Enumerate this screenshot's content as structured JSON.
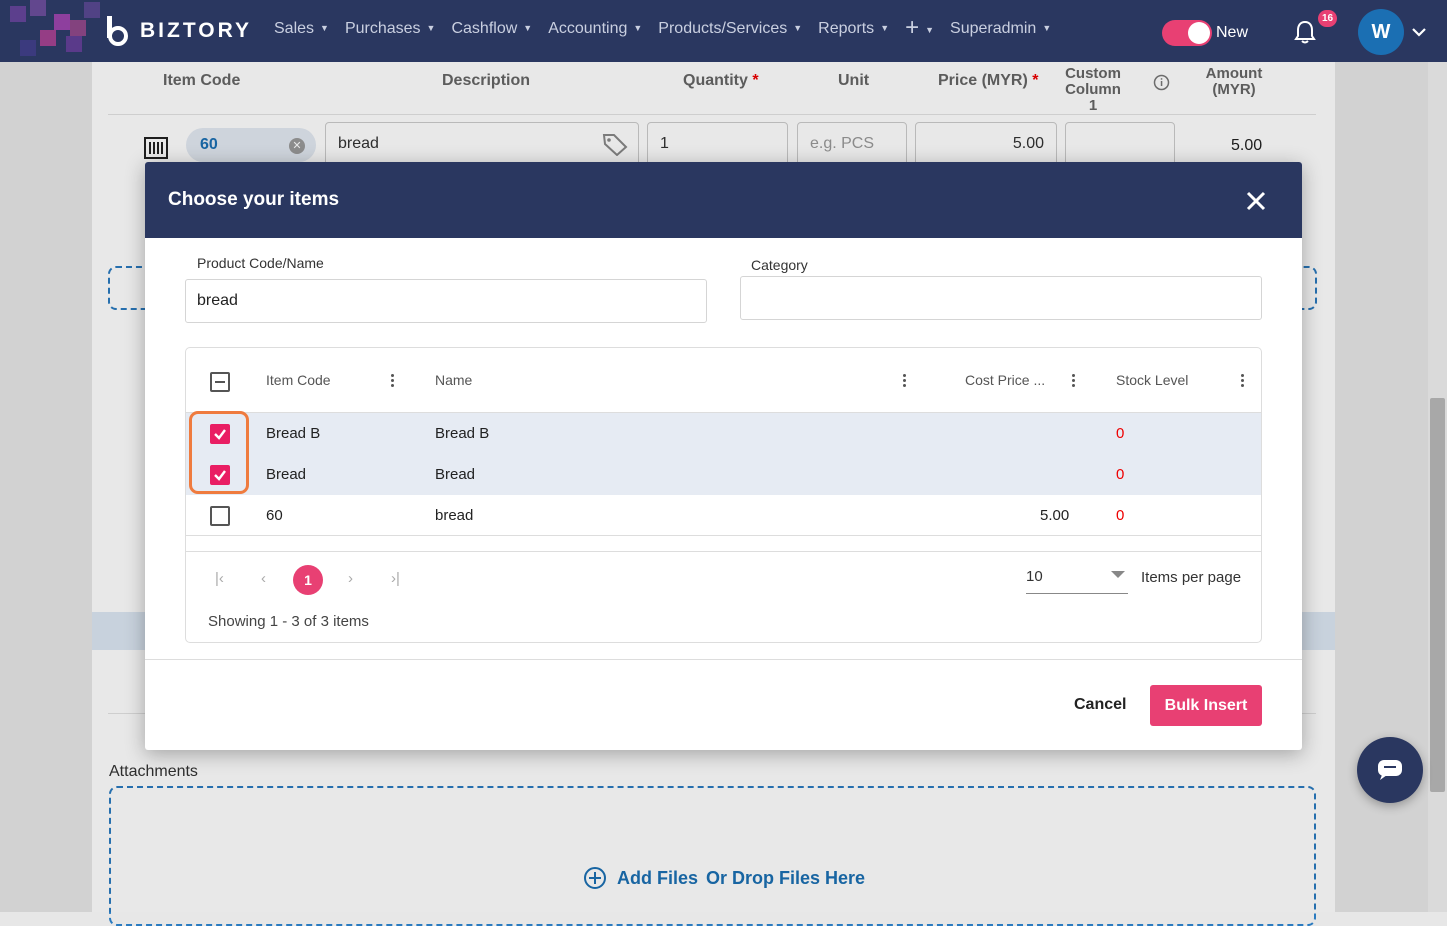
{
  "topnav": {
    "brand": "BIZTORY",
    "menu": [
      {
        "label": "Sales"
      },
      {
        "label": "Purchases"
      },
      {
        "label": "Cashflow"
      },
      {
        "label": "Accounting"
      },
      {
        "label": "Products/Services"
      },
      {
        "label": "Reports"
      },
      {
        "label": "+"
      },
      {
        "label": "Superadmin"
      }
    ],
    "toggle_label": "New",
    "notification_count": "16",
    "avatar_initial": "W",
    "brand_color": "#2a3760",
    "accent_color": "#e84073"
  },
  "background": {
    "columns": {
      "item_code": "Item Code",
      "description": "Description",
      "quantity": "Quantity",
      "unit": "Unit",
      "price": "Price (MYR)",
      "custom_column_1": "Custom Column 1",
      "amount": "Amount (MYR)"
    },
    "required_marker": "*",
    "line": {
      "item_code": "60",
      "description": "bread",
      "quantity": "1",
      "unit_placeholder": "e.g. PCS",
      "price": "5.00",
      "amount": "5.00"
    },
    "attachments_label": "Attachments",
    "add_files": "Add Files",
    "drop_files": "Or Drop Files Here"
  },
  "modal": {
    "title": "Choose your items",
    "filters": {
      "product_label": "Product Code/Name",
      "product_value": "bread",
      "category_label": "Category",
      "category_value": ""
    },
    "grid": {
      "headers": {
        "item_code": "Item Code",
        "name": "Name",
        "cost_price": "Cost Price ...",
        "stock_level": "Stock Level"
      },
      "rows": [
        {
          "checked": true,
          "item_code": "Bread B",
          "name": "Bread B",
          "cost_price": "",
          "stock_level": "0"
        },
        {
          "checked": true,
          "item_code": "Bread",
          "name": "Bread",
          "cost_price": "",
          "stock_level": "0"
        },
        {
          "checked": false,
          "item_code": "60",
          "name": "bread",
          "cost_price": "5.00",
          "stock_level": "0"
        }
      ],
      "current_page": "1",
      "page_size": "10",
      "items_per_page_label": "Items per page",
      "showing": "Showing 1 - 3 of 3 items"
    },
    "cancel_label": "Cancel",
    "submit_label": "Bulk Insert"
  },
  "icons": {
    "close": "close-icon",
    "bell": "bell-icon",
    "chat": "chat-icon",
    "barcode": "barcode-icon",
    "tag": "tag-icon"
  }
}
